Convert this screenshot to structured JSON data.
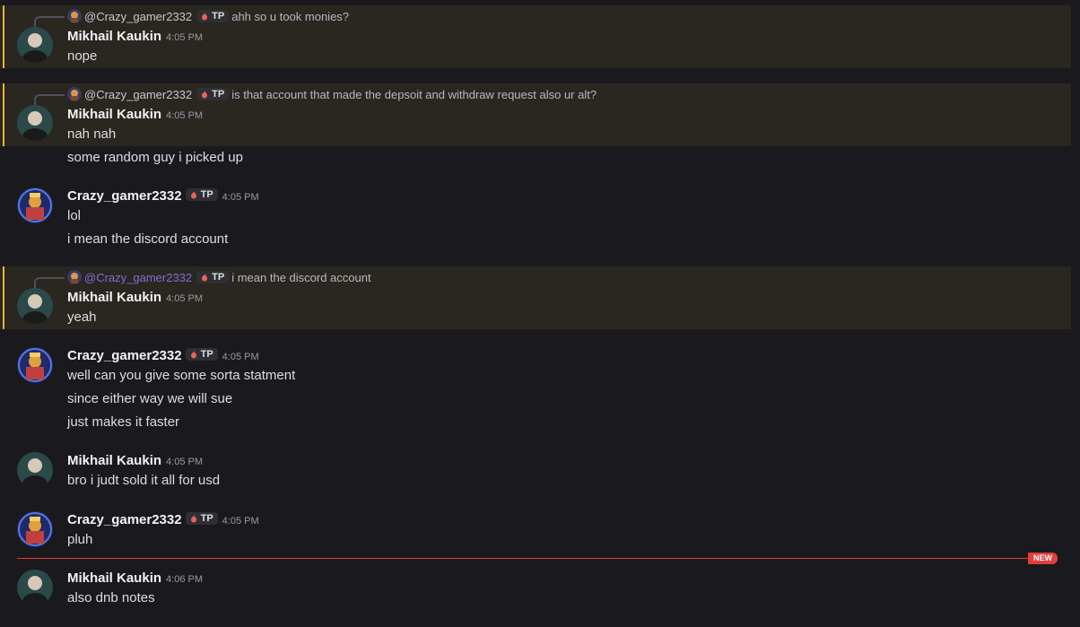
{
  "users": {
    "mikhail": "Mikhail Kaukin",
    "crazy": "Crazy_gamer2332"
  },
  "tag_label": "TP",
  "reply_mention_prefix": "@",
  "messages": [
    {
      "author": "Mikhail Kaukin",
      "time": "4:05 PM",
      "reply_to": "@Crazy_gamer2332",
      "reply_text": "ahh so u took monies?",
      "lines": [
        "nope"
      ]
    },
    {
      "author": "Mikhail Kaukin",
      "time": "4:05 PM",
      "reply_to": "@Crazy_gamer2332",
      "reply_text": "is that account that made the depsoit and withdraw request also ur alt?",
      "lines": [
        "nah nah",
        "some random guy i picked up"
      ]
    },
    {
      "author": "Crazy_gamer2332",
      "time": "4:05 PM",
      "lines": [
        "lol",
        "i mean the discord account"
      ]
    },
    {
      "author": "Mikhail Kaukin",
      "time": "4:05 PM",
      "reply_to": "@Crazy_gamer2332",
      "reply_text": "i mean the discord account",
      "lines": [
        "yeah"
      ]
    },
    {
      "author": "Crazy_gamer2332",
      "time": "4:05 PM",
      "lines": [
        "well can you give some sorta statment",
        "since either way we will sue",
        "just makes it faster"
      ]
    },
    {
      "author": "Mikhail Kaukin",
      "time": "4:05 PM",
      "lines": [
        "bro i judt sold it all for usd"
      ]
    },
    {
      "author": "Crazy_gamer2332",
      "time": "4:05 PM",
      "lines": [
        "pluh"
      ]
    },
    {
      "author": "Mikhail Kaukin",
      "time": "4:06 PM",
      "lines": [
        "also dnb notes"
      ]
    }
  ],
  "new_divider_label": "NEW",
  "colors": {
    "background": "#1a1a1e",
    "highlight": "#2a2620",
    "highlight_bar": "#f0b232",
    "new_line": "#e23d3d",
    "mention": "#7d6fd8"
  }
}
